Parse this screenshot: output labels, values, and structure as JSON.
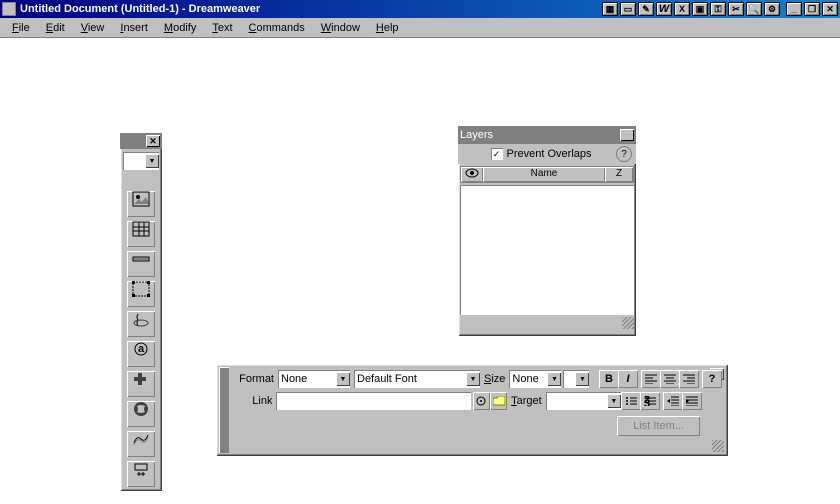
{
  "title": "Untitled Document (Untitled-1) - Dreamweaver",
  "menu": [
    "File",
    "Edit",
    "View",
    "Insert",
    "Modify",
    "Text",
    "Commands",
    "Window",
    "Help"
  ],
  "tray_icons": [
    "app",
    "doc",
    "write",
    "W",
    "X",
    "restore",
    "key",
    "scissors",
    "magnify",
    "gear"
  ],
  "win_controls": [
    "_",
    "❐",
    "✕"
  ],
  "layers": {
    "title": "Layers",
    "prevent_overlaps_label": "Prevent Overlaps",
    "prevent_overlaps_checked": true,
    "col_name": "Name",
    "col_z": "Z"
  },
  "properties": {
    "format_label": "Format",
    "format_value": "None",
    "font_value": "Default Font",
    "size_label": "Size",
    "size_value": "None",
    "link_label": "Link",
    "link_value": "",
    "target_label": "Target",
    "target_value": "",
    "list_item_label": "List Item..."
  }
}
